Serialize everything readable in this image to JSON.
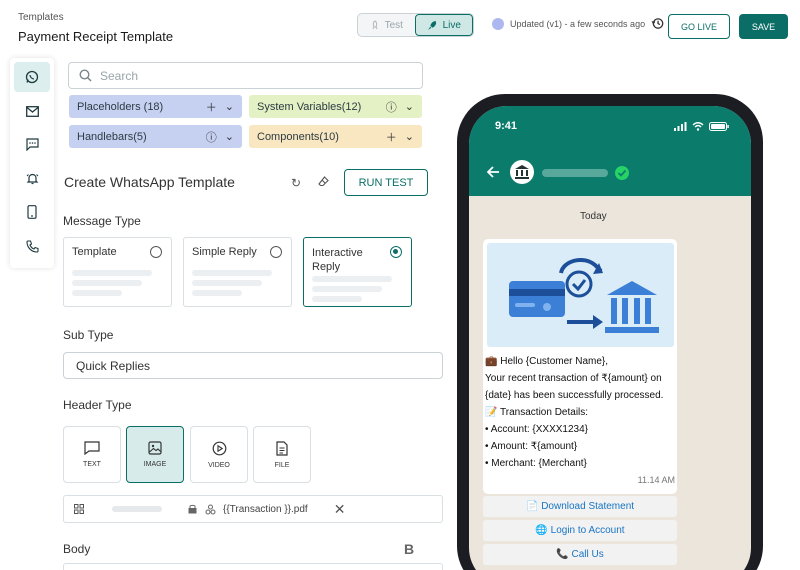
{
  "header": {
    "breadcrumb": "Templates",
    "title": "Payment Receipt Template",
    "mode_test": "Test",
    "mode_live": "Live",
    "updated": "Updated (v1) - a few seconds ago",
    "go_live": "GO LIVE",
    "save": "SAVE"
  },
  "rail": {
    "icons": [
      "whatsapp-icon",
      "mail-icon",
      "chat-icon",
      "bell-icon",
      "mobile-icon",
      "phone-icon"
    ]
  },
  "search": {
    "placeholder": "Search"
  },
  "chips": {
    "placeholders": "Placeholders (18)",
    "system_variables": "System Variables(12)",
    "handlebars": "Handlebars(5)",
    "components": "Components(10)"
  },
  "editor": {
    "heading": "Create WhatsApp Template",
    "run_test": "RUN TEST",
    "message_type_label": "Message Type",
    "message_types": [
      "Template",
      "Simple Reply",
      "Interactive Reply"
    ],
    "selected_message_type": "Interactive Reply",
    "sub_type_label": "Sub Type",
    "sub_type_value": "Quick Replies",
    "header_type_label": "Header Type",
    "header_types": [
      "TEXT",
      "IMAGE",
      "VIDEO",
      "FILE"
    ],
    "selected_header_type": "IMAGE",
    "file_name": "{{Transaction }}.pdf",
    "body_label": "Body",
    "body_tool_bold": "B"
  },
  "preview": {
    "clock": "9:41",
    "day": "Today",
    "message_lines": [
      "💼 Hello {Customer Name},",
      "Your recent transaction of ₹{amount} on",
      "{date} has been successfully processed.",
      "📝 Transaction Details:",
      "• Account: {XXXX1234}",
      "• Amount: ₹{amount}",
      "• Merchant: {Merchant}"
    ],
    "time": "11.14 AM",
    "buttons": [
      "📄 Download Statement",
      "🌐 Login to Account",
      "📞 Call Us"
    ]
  },
  "colors": {
    "brand": "#0b6e66",
    "wa_header": "#0b7c6c"
  }
}
